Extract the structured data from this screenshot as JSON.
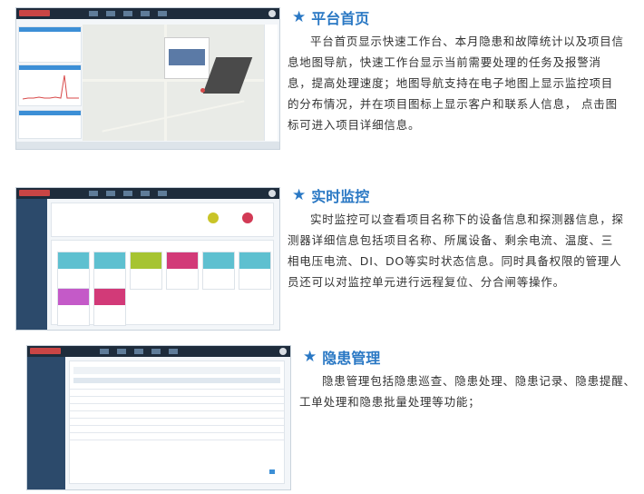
{
  "sections": [
    {
      "title": "平台首页",
      "body": "平台首页显示快速工作台、本月隐患和故障统计以及项目信息地图导航，快速工作台显示当前需要处理的任务及报警消息，提高处理速度；地图导航支持在电子地图上显示监控项目的分布情况，并在项目图标上显示客户和联系人信息， 点击图标可进入项目详细信息。"
    },
    {
      "title": "实时监控",
      "body": "实时监控可以查看项目名称下的设备信息和探测器信息，探测器详细信息包括项目名称、所属设备、剩余电流、温度、三相电压电流、DI、DO等实时状态信息。同时具备权限的管理人员还可以对监控单元进行远程复位、分合闸等操作。"
    },
    {
      "title": "隐患管理",
      "body": "隐患管理包括隐患巡查、隐患处理、隐患记录、隐患提醒、工单处理和隐患批量处理等功能；"
    }
  ],
  "colors": {
    "accent": "#2a78c4",
    "text": "#333333",
    "nav": "#1e2c3c"
  },
  "icons": {
    "heading": "star-icon"
  }
}
